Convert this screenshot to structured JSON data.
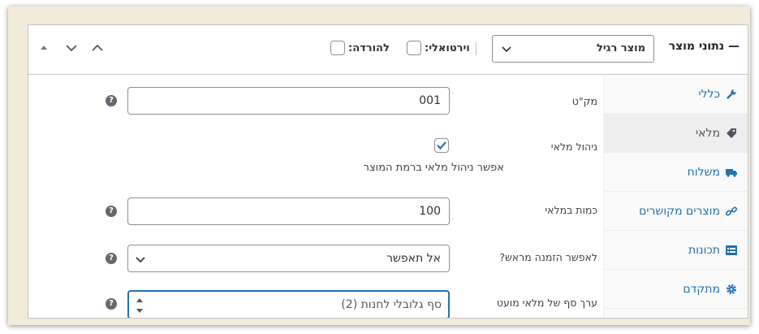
{
  "header": {
    "title": "נתוני מוצר —",
    "product_type": "מוצר רגיל",
    "virtual_label": "וירטואלי:",
    "downloadable_label": "להורדה:"
  },
  "tabs": [
    {
      "label": "כללי",
      "icon": "wrench-icon"
    },
    {
      "label": "מלאי",
      "icon": "tag-icon",
      "active": true
    },
    {
      "label": "משלוח",
      "icon": "truck-icon"
    },
    {
      "label": "מוצרים מקושרים",
      "icon": "link-icon"
    },
    {
      "label": "תכונות",
      "icon": "list-icon"
    },
    {
      "label": "מתקדם",
      "icon": "gear-icon"
    }
  ],
  "fields": {
    "sku": {
      "label": "מק\"ט",
      "value": "001"
    },
    "manage_stock": {
      "label": "ניהול מלאי",
      "checked": true,
      "description": "אפשר ניהול מלאי ברמת המוצר"
    },
    "quantity": {
      "label": "כמות במלאי",
      "value": "100"
    },
    "backorders": {
      "label": "לאפשר הזמנה מראש?",
      "value": "אל תאפשר"
    },
    "low_stock": {
      "label": "ערך סף של מלאי מועט",
      "placeholder": "סף גלובלי לחנות (2)"
    }
  },
  "colors": {
    "accent": "#2271b1",
    "text": "#3c434a"
  }
}
